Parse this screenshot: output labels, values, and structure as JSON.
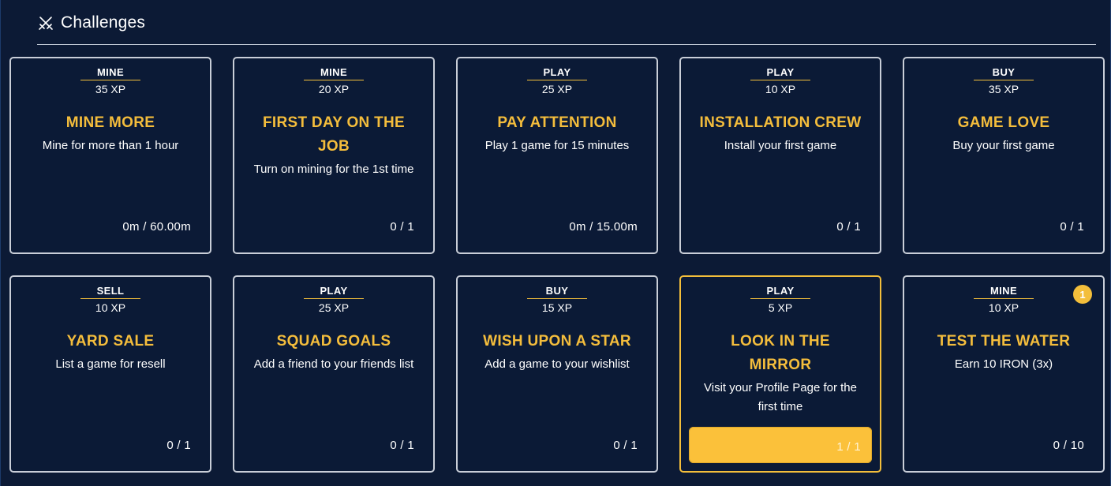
{
  "header": {
    "title": "Challenges",
    "icon": "crossed-swords-icon"
  },
  "colors": {
    "accent": "#f4bd3c",
    "background": "#0c1a35",
    "card_border": "#c9ced8"
  },
  "challenges": [
    {
      "category": "MINE",
      "xp": "35 XP",
      "name": "MINE MORE",
      "description": "Mine for more than 1 hour",
      "progress": "0m / 60.00m",
      "progress_fraction": 0
    },
    {
      "category": "MINE",
      "xp": "20 XP",
      "name": "FIRST DAY ON THE JOB",
      "description": "Turn on mining for the 1st time",
      "progress": "0 / 1",
      "progress_fraction": 0
    },
    {
      "category": "PLAY",
      "xp": "25 XP",
      "name": "PAY ATTENTION",
      "description": "Play 1 game for 15 minutes",
      "progress": "0m / 15.00m",
      "progress_fraction": 0
    },
    {
      "category": "PLAY",
      "xp": "10 XP",
      "name": "INSTALLATION CREW",
      "description": "Install your first game",
      "progress": "0 / 1",
      "progress_fraction": 0
    },
    {
      "category": "BUY",
      "xp": "35 XP",
      "name": "GAME LOVE",
      "description": "Buy your first game",
      "progress": "0 / 1",
      "progress_fraction": 0
    },
    {
      "category": "SELL",
      "xp": "10 XP",
      "name": "YARD SALE",
      "description": "List a game for resell",
      "progress": "0 / 1",
      "progress_fraction": 0
    },
    {
      "category": "PLAY",
      "xp": "25 XP",
      "name": "SQUAD GOALS",
      "description": "Add a friend to your friends list",
      "progress": "0 / 1",
      "progress_fraction": 0
    },
    {
      "category": "BUY",
      "xp": "15 XP",
      "name": "WISH UPON A STAR",
      "description": "Add a game to your wishlist",
      "progress": "0 / 1",
      "progress_fraction": 0
    },
    {
      "category": "PLAY",
      "xp": "5 XP",
      "name": "LOOK IN THE MIRROR",
      "description": "Visit your Profile Page for the first time",
      "progress": "1 / 1",
      "progress_fraction": 1,
      "completed": true
    },
    {
      "category": "MINE",
      "xp": "10 XP",
      "name": "TEST THE WATER",
      "description": "Earn 10 IRON (3x)",
      "progress": "0 / 10",
      "progress_fraction": 0,
      "badge": "1"
    }
  ]
}
